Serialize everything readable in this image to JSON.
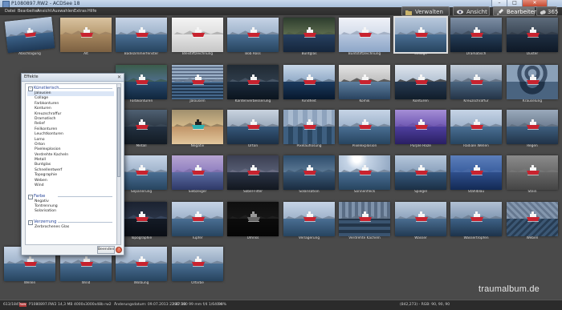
{
  "window": {
    "title": "P1080897.RW2 - ACDSee 18",
    "btn_minimize": "–",
    "btn_maximize": "□",
    "btn_close": "✕"
  },
  "menu": [
    "Datei",
    "Bearbeiten",
    "Ansicht",
    "Auswahlen",
    "Extras",
    "Hilfe"
  ],
  "modes": [
    {
      "label": "Verwalten",
      "icon": "folder-icon",
      "active": false
    },
    {
      "label": "Ansicht",
      "icon": "eye-icon",
      "active": false
    },
    {
      "label": "Bearbeiten",
      "icon": "brush-icon",
      "active": true
    },
    {
      "label": "365",
      "icon": "cloud-icon",
      "active": false
    }
  ],
  "thumbnails": [
    {
      "label": "Abschlagung",
      "style": "tilt"
    },
    {
      "label": "Alt",
      "style": "sepia"
    },
    {
      "label": "Badezimmerfenster",
      "style": "normal"
    },
    {
      "label": "Bleistiftzeichnung",
      "style": "sketch"
    },
    {
      "label": "Bob Ross",
      "style": "normal"
    },
    {
      "label": "Buntglas",
      "style": "glass"
    },
    {
      "label": "Buntstiftzeichnung",
      "style": "sketch2"
    },
    {
      "label": "Collage",
      "style": "collage"
    },
    {
      "label": "Dramatisch",
      "style": "dramatic"
    },
    {
      "label": "Düster",
      "style": "dark"
    },
    {
      "label": "",
      "style": "hidden"
    },
    {
      "label": "",
      "style": "hidden"
    },
    {
      "label": "Farbkonturen",
      "style": "contour"
    },
    {
      "label": "Jalousien",
      "style": "blinds"
    },
    {
      "label": "Kantenverbesserung",
      "style": "edge"
    },
    {
      "label": "Kindheit",
      "style": "child"
    },
    {
      "label": "Komik",
      "style": "comic"
    },
    {
      "label": "Konturen",
      "style": "contour2"
    },
    {
      "label": "Kreuzschraffur",
      "style": "hatch"
    },
    {
      "label": "Kräuselung",
      "style": "ripple"
    },
    {
      "label": "",
      "style": "hidden"
    },
    {
      "label": "",
      "style": "hidden"
    },
    {
      "label": "Metall",
      "style": "metal"
    },
    {
      "label": "Negativ",
      "style": "negative"
    },
    {
      "label": "Orton",
      "style": "orton"
    },
    {
      "label": "Pixelauflösung",
      "style": "pixel"
    },
    {
      "label": "Pixelexplosion",
      "style": "normal"
    },
    {
      "label": "Purple Haze",
      "style": "purple"
    },
    {
      "label": "Radiale Wellen",
      "style": "normal"
    },
    {
      "label": "Regen",
      "style": "rain"
    },
    {
      "label": "",
      "style": "hidden"
    },
    {
      "label": "",
      "style": "hidden"
    },
    {
      "label": "Separierung",
      "style": "normal"
    },
    {
      "label": "Siebzeiger",
      "style": "sieb"
    },
    {
      "label": "Sobel-Filter",
      "style": "sobel"
    },
    {
      "label": "Solarisation",
      "style": "solar"
    },
    {
      "label": "Sonnenfleck",
      "style": "sun"
    },
    {
      "label": "Spiegel",
      "style": "mirror"
    },
    {
      "label": "Stahlblau",
      "style": "steel"
    },
    {
      "label": "Stein",
      "style": "stone"
    },
    {
      "label": "",
      "style": "hidden"
    },
    {
      "label": "",
      "style": "hidden"
    },
    {
      "label": "Topographie",
      "style": "topo"
    },
    {
      "label": "Tupfer",
      "style": "normal"
    },
    {
      "label": "Umriss",
      "style": "outline"
    },
    {
      "label": "Verlagerung",
      "style": "normal"
    },
    {
      "label": "Verdrehte Kacheln",
      "style": "tiles"
    },
    {
      "label": "Wasser",
      "style": "water"
    },
    {
      "label": "Wassertropfen",
      "style": "drops"
    },
    {
      "label": "Weben",
      "style": "weave"
    },
    {
      "label": "Wellen",
      "style": "normal"
    },
    {
      "label": "Wind",
      "style": "normal"
    },
    {
      "label": "Wölbung",
      "style": "normal"
    },
    {
      "label": "Ölfarbe",
      "style": "oil"
    }
  ],
  "dialog": {
    "title": "Effekte",
    "close": "✕",
    "groups": [
      {
        "name": "Künstlerisch",
        "toggle": "–",
        "items": [
          "Jalousien",
          "Collage",
          "Farbkonturen",
          "Konturen",
          "Kreuzschraffur",
          "Dramatisch",
          "Relief",
          "Feilkonturen",
          "Leuchtkonturen",
          "Lomo",
          "Orton",
          "Pixelexplosion",
          "Verdrehte Kacheln",
          "Metall",
          "Buntglas",
          "Schnellentwerf",
          "Topographie",
          "Weben",
          "Wind"
        ]
      },
      {
        "name": "Farbe",
        "toggle": "–",
        "items": [
          "Negativ",
          "Tontrennung",
          "Solarisation"
        ]
      },
      {
        "name": "Verzerrung",
        "toggle": "–",
        "items": [
          "Zerbrochenes Glas"
        ]
      }
    ],
    "done_button": "Beenden",
    "help": "?"
  },
  "status": {
    "count": "613/1845",
    "badge": "RAW",
    "filename": "P1080897.RW2",
    "size": "14,3 MB",
    "dimensions": "4000x3000x48b rw2",
    "date": "Änderungsdatum: 09.07.2013 22:47:38",
    "exposure": "ISO 100   99 mm   f/4   1/640 s",
    "zoom": "99%",
    "coords": "(842,273) - RGB: 90, 90, 90"
  },
  "watermark": "traumalbum.de",
  "colors": {
    "background": "#4a4a4a",
    "menubar": "#2c2c2c",
    "dialog": "#eef1f4",
    "group_header": "#26459a"
  }
}
